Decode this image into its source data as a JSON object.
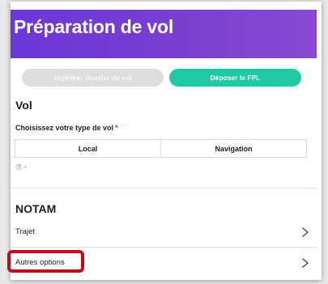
{
  "header": {
    "title": "Préparation de vol"
  },
  "actions": {
    "print_label": "Imprimer dossier de vol",
    "fpl_label": "Déposer le FPL"
  },
  "vol": {
    "title": "Vol",
    "type_label": "Choisissez votre type de vol",
    "required_marker": "*",
    "types": [
      {
        "label": "Local"
      },
      {
        "label": "Navigation"
      }
    ],
    "help_icon": "?",
    "help_text": "x"
  },
  "notam": {
    "title": "NOTAM",
    "items": [
      {
        "label": "Trajet",
        "icon": "chevron-right-icon"
      },
      {
        "label": "Autres options",
        "icon": "chevron-right-icon"
      }
    ]
  },
  "colors": {
    "header_start": "#6a36d8",
    "header_end": "#8a4ad1",
    "accent": "#1ec9a4",
    "disabled": "#dedede",
    "highlight": "#c00d1e",
    "required": "#d0243a"
  }
}
